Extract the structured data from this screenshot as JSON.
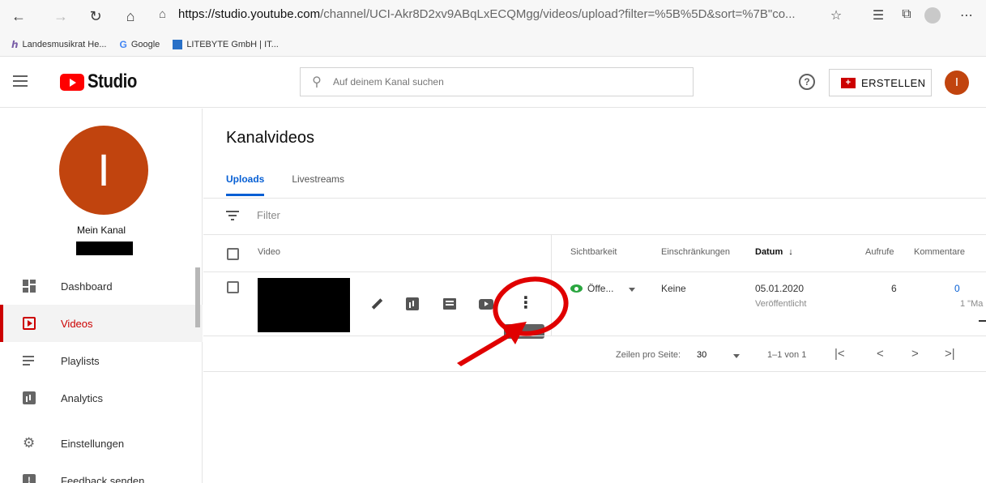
{
  "browser": {
    "url_host": "https://studio.youtube.com",
    "url_path": "/channel/UCI-Akr8D2xv9ABqLxECQMgg/videos/upload?filter=%5B%5D&sort=%7B\"co...",
    "bookmarks": [
      {
        "label": "Landesmusikrat He...",
        "icon": "f"
      },
      {
        "label": "Google",
        "icon": "G"
      },
      {
        "label": "LITEBYTE GmbH | IT...",
        "icon": "l"
      }
    ]
  },
  "header": {
    "logo_text": "Studio",
    "search_placeholder": "Auf deinem Kanal suchen",
    "help_glyph": "?",
    "create_label": "ERSTELLEN",
    "create_icon_glyph": "+",
    "avatar_initial": "I"
  },
  "sidebar": {
    "avatar_initial": "I",
    "channel_name": "Mein Kanal",
    "items": [
      {
        "label": "Dashboard",
        "icon": "dashboard-icon",
        "active": false
      },
      {
        "label": "Videos",
        "icon": "videos-icon",
        "active": true
      },
      {
        "label": "Playlists",
        "icon": "playlists-icon",
        "active": false
      },
      {
        "label": "Analytics",
        "icon": "analytics-icon",
        "active": false
      },
      {
        "label": "Einstellungen",
        "icon": "settings-icon",
        "active": false
      },
      {
        "label": "Feedback senden",
        "icon": "feedback-icon",
        "active": false
      }
    ],
    "feedback_glyph": "!"
  },
  "main": {
    "title": "Kanalvideos",
    "tabs": [
      {
        "label": "Uploads",
        "active": true
      },
      {
        "label": "Livestreams",
        "active": false
      }
    ],
    "filter_placeholder": "Filter",
    "columns": {
      "video": "Video",
      "visibility": "Sichtbarkeit",
      "restrictions": "Einschränkungen",
      "date": "Datum",
      "date_sort": "↓",
      "views": "Aufrufe",
      "comments": "Kommentare"
    },
    "row": {
      "visibility": "Öffe...",
      "restrictions": "Keine",
      "date": "05.01.2020",
      "date_status": "Veröffentlicht",
      "views": "6",
      "comments": "0",
      "comments_sub": "1 \"Ma",
      "more_glyph": "⋮"
    },
    "pagination": {
      "rows_per_page_label": "Zeilen pro Seite:",
      "rows_per_page": "30",
      "range": "1–1 von 1",
      "first": "|<",
      "prev": "<",
      "next": ">",
      "last": ">|"
    }
  },
  "colors": {
    "accent_red": "#cc0000",
    "link_blue": "#065fd4",
    "visible_green": "#2ba640",
    "avatar": "#c1440e",
    "annotation": "#e00000"
  }
}
